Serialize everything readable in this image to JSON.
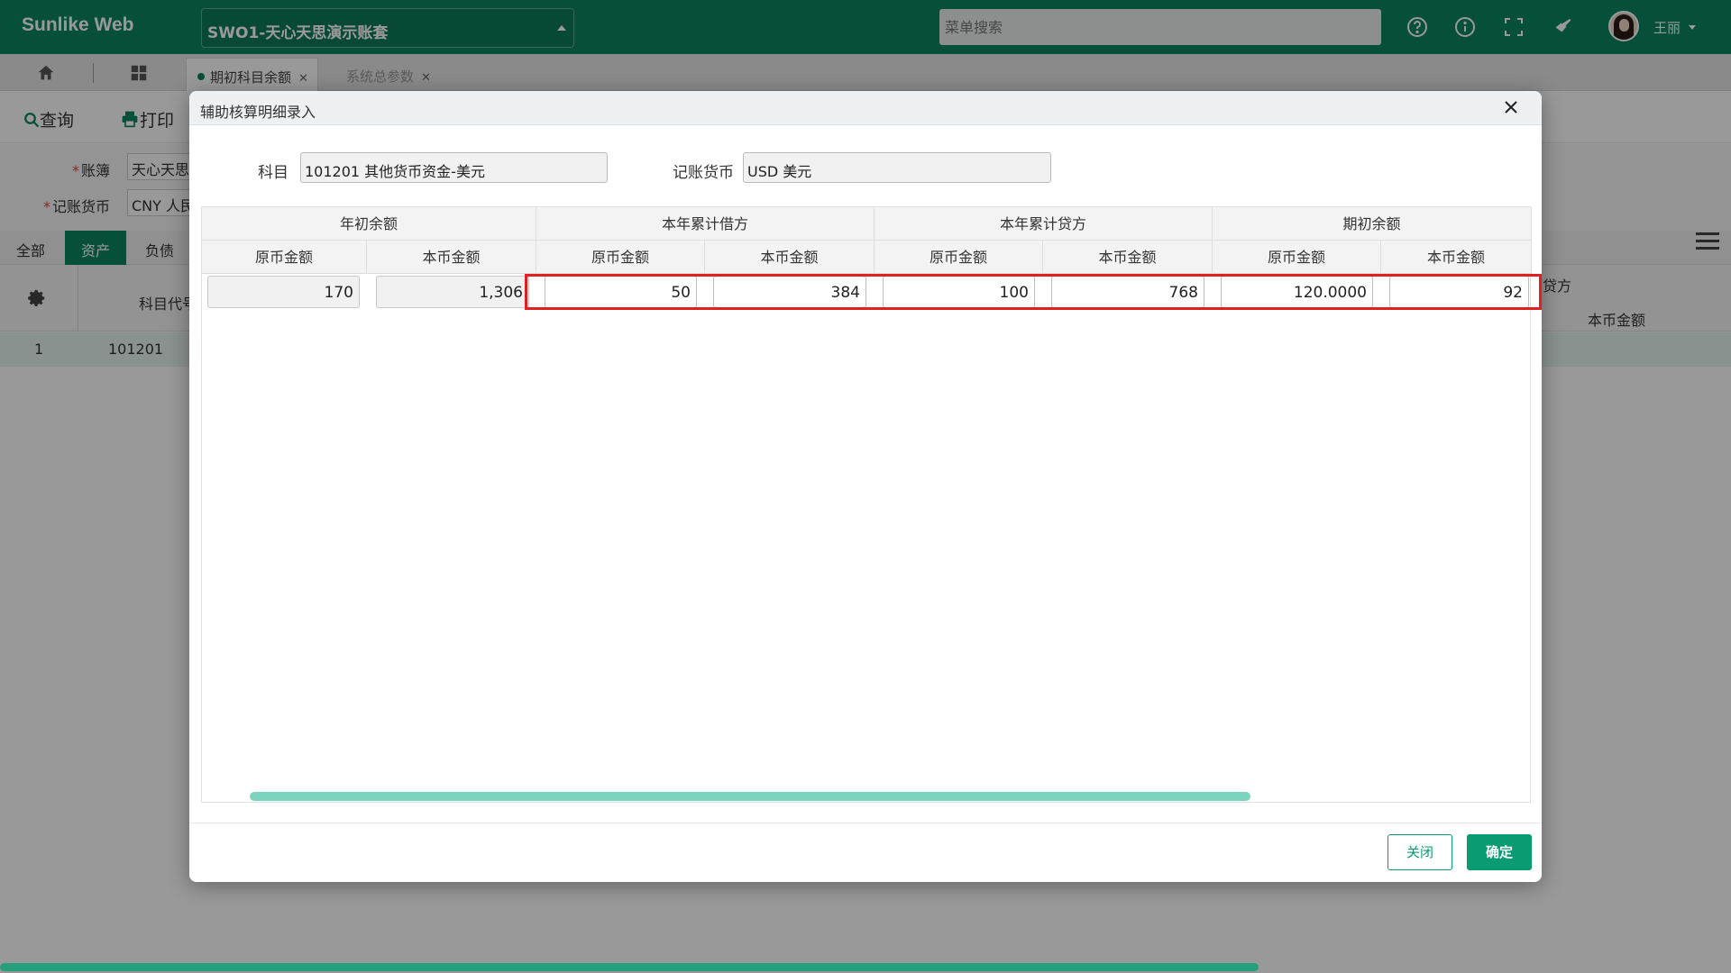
{
  "app": {
    "logo": "Sunlike Web",
    "account_set": "SWO1-天心天思演示账套",
    "search_placeholder": "菜单搜索",
    "user": "王丽"
  },
  "tabs": [
    {
      "label": "期初科目余额",
      "active": true
    },
    {
      "label": "系统总参数",
      "active": false
    }
  ],
  "toolbar": {
    "query": "查询",
    "print": "打印"
  },
  "filter": {
    "book_label": "账簿",
    "book_value": "天心天思",
    "currency_label": "记账货币",
    "currency_value": "CNY 人民"
  },
  "category_tabs": [
    "全部",
    "资产",
    "负债"
  ],
  "grid": {
    "header_code": "科目代号",
    "header_credit": "贷方",
    "header_local": "本币金额",
    "row": {
      "index": "1",
      "code": "101201"
    }
  },
  "modal": {
    "title": "辅助核算明细录入",
    "subject_label": "科目",
    "subject_value": "101201 其他货币资金-美元",
    "currency_label": "记账货币",
    "currency_value": "USD 美元",
    "group_headers": [
      "年初余额",
      "本年累计借方",
      "本年累计贷方",
      "期初余额"
    ],
    "sub_headers": [
      "原币金额",
      "本币金额",
      "原币金额",
      "本币金额",
      "原币金额",
      "本币金额",
      "原币金额",
      "本币金额"
    ],
    "row_values": [
      "170",
      "1,306",
      "50",
      "384",
      "100",
      "768",
      "120.0000",
      "92"
    ],
    "close_button": "关闭",
    "ok_button": "确定"
  },
  "colors": {
    "brand": "#0a8460",
    "button": "#0a9b72",
    "highlight": "#e02020"
  }
}
